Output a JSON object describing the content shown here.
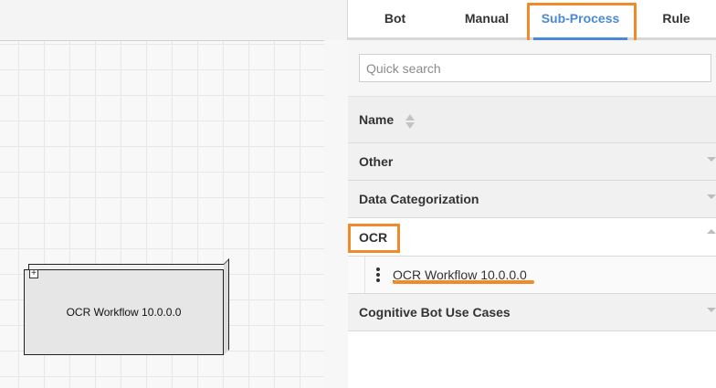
{
  "canvas": {
    "process_box": {
      "label": "OCR Workflow 10.0.0.0",
      "expand_symbol": "+"
    }
  },
  "tabs": [
    {
      "label": "Bot",
      "active": false
    },
    {
      "label": "Manual",
      "active": false
    },
    {
      "label": "Sub-Process",
      "active": true
    },
    {
      "label": "Rule",
      "active": false
    }
  ],
  "search": {
    "placeholder": "Quick search",
    "value": ""
  },
  "list": {
    "header": {
      "label": "Name"
    },
    "groups": [
      {
        "label": "Other",
        "expanded": false
      },
      {
        "label": "Data Categorization",
        "expanded": false
      },
      {
        "label": "OCR",
        "expanded": true,
        "items": [
          {
            "label": "OCR Workflow 10.0.0.0"
          }
        ]
      },
      {
        "label": "Cognitive Bot Use Cases",
        "expanded": false
      }
    ]
  },
  "colors": {
    "accent": "#4a8ad4",
    "highlight": "#f08a2b"
  },
  "icons": [
    "sort-icon",
    "caret-down-icon",
    "caret-up-icon",
    "kebab-icon",
    "expand-icon"
  ]
}
